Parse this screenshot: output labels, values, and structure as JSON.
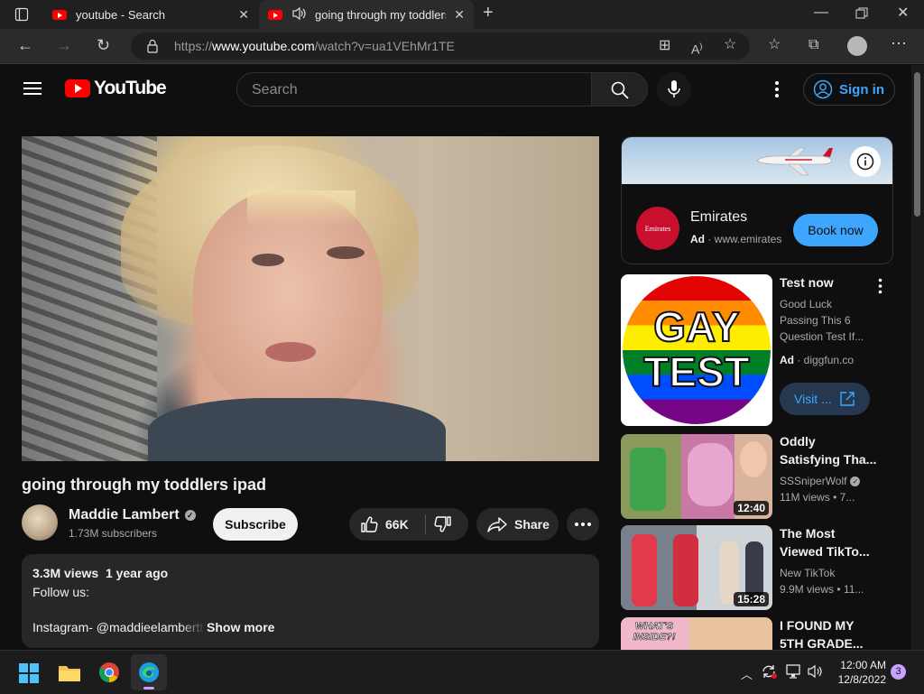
{
  "browser": {
    "tabs": [
      {
        "title": "youtube - Search",
        "active": false
      },
      {
        "title": "going through my toddlers ipad",
        "active": true
      }
    ],
    "address": {
      "prefix": "https://",
      "domain": "www.youtube.com",
      "path": "/watch?v=ua1VEhMr1TE"
    }
  },
  "masthead": {
    "logo_text": "YouTube",
    "search_placeholder": "Search",
    "signin_label": "Sign in"
  },
  "video": {
    "title": "going through my toddlers ipad",
    "channel": {
      "name": "Maddie Lambert",
      "subscribers": "1.73M subscribers"
    },
    "subscribe_label": "Subscribe",
    "likes": "66K",
    "share_label": "Share",
    "description": {
      "views": "3.3M views",
      "age": "1 year ago",
      "line1": "Follow us:",
      "line2": "Instagram- @maddieelambertt",
      "show_more": "Show more"
    }
  },
  "ad_card": {
    "brand": "Emirates",
    "ad_label": "Ad",
    "domain": "www.emirates",
    "cta": "Book now",
    "logo_text": "Emirates"
  },
  "related": [
    {
      "title": "Test now",
      "description": "Good Luck Passing This 6 Question Test If...",
      "ad_label": "Ad",
      "domain": "diggfun.co",
      "cta": "Visit ...",
      "thumb_line1": "GAY",
      "thumb_line2": "TEST"
    },
    {
      "title": "Oddly Satisfying Tha...",
      "channel": "SSSniperWolf",
      "views": "11M views",
      "age": "7...",
      "duration": "12:40"
    },
    {
      "title": "The Most Viewed TikTo...",
      "channel": "New TikTok",
      "views": "9.9M views",
      "age": "11...",
      "duration": "15:28"
    },
    {
      "title": "I FOUND MY 5TH GRADE...",
      "thumb_text": "WHAT'S INSIDE?!"
    }
  ],
  "taskbar": {
    "time": "12:00 AM",
    "date": "12/8/2022",
    "notification_count": "3"
  },
  "colors": {
    "accent": "#3ea6ff",
    "yt_red": "#ff0000",
    "book_now": "#3ea6ff"
  }
}
